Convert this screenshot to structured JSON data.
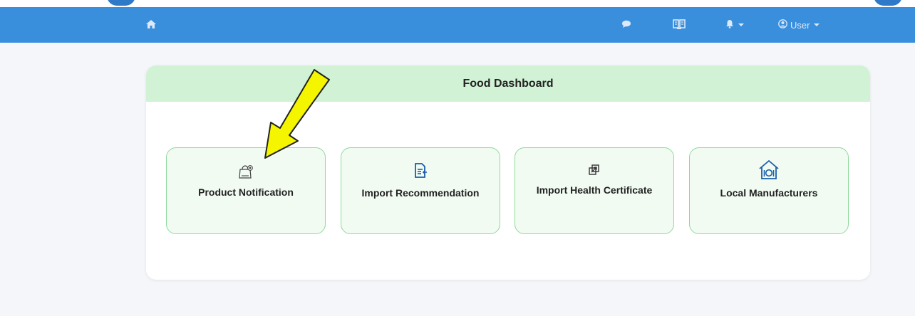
{
  "navbar": {
    "home_icon": "home-icon",
    "chat_icon": "chat-bubble-icon",
    "book_icon": "book-icon",
    "bell_icon": "bell-icon",
    "user_icon": "user-circle-icon",
    "user_label": "User",
    "bg_color": "#3a8fdd"
  },
  "dashboard": {
    "title": "Food Dashboard",
    "header_color": "#d2f2d6",
    "tiles": [
      {
        "label": "Product Notification",
        "icon": "shopping-bag-icon"
      },
      {
        "label": "Import Recommendation",
        "icon": "document-import-icon"
      },
      {
        "label": "Import Health Certificate",
        "icon": "certificate-link-icon"
      },
      {
        "label": "Local Manufacturers",
        "icon": "restaurant-house-icon"
      }
    ]
  },
  "annotation": {
    "arrow_color": "#f5f500",
    "arrow_target": "Product Notification"
  }
}
